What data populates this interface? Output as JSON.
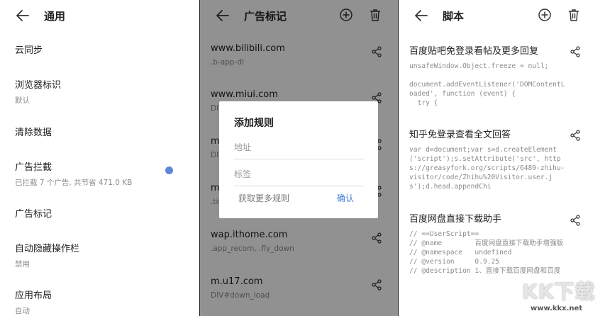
{
  "general": {
    "title": "通用",
    "items": [
      {
        "label": "云同步",
        "sub": ""
      },
      {
        "label": "浏览器标识",
        "sub": "默认"
      },
      {
        "label": "清除数据",
        "sub": ""
      },
      {
        "label": "广告拦截",
        "sub": "已拦截 7 个广告, 共节省 471.0 KB"
      },
      {
        "label": "广告标记",
        "sub": ""
      },
      {
        "label": "自动隐藏操作栏",
        "sub": "禁用"
      },
      {
        "label": "应用布局",
        "sub": "自动"
      }
    ],
    "toggle_color": "#5f87d8"
  },
  "adrules": {
    "title": "广告标记",
    "rows": [
      {
        "domain": "www.bilibili.com",
        "selector": ".b-app-dl"
      },
      {
        "domain": "www.miui.com",
        "selector": "DIV"
      },
      {
        "domain": "m",
        "selector": "DIV"
      },
      {
        "domain": "m",
        "selector": ".tis"
      },
      {
        "domain": "wap.ithome.com",
        "selector": ".app_recom, .fly_down"
      },
      {
        "domain": "m.u17.com",
        "selector": "DIV#down_load"
      }
    ],
    "dialog": {
      "title": "添加规则",
      "address_placeholder": "地址",
      "tag_placeholder": "标签",
      "more_rules": "获取更多规则",
      "confirm": "确认"
    }
  },
  "scripts": {
    "title": "脚本",
    "items": [
      {
        "name": "百度贴吧免登录看帖及更多回复",
        "code": "unsafeWindow.Object.freeze = null;\n\ndocument.addEventListener('DOMContentLoaded', function (event) {\n  try {"
      },
      {
        "name": "知乎免登录查看全文回答",
        "code": "var d=document;var s=d.createElement('script');s.setAttribute('src', https://greasyfork.org/scripts/6489-zhihu-visitor/code/Zhihu%20Visitor.user.js');d.head.appendChi"
      },
      {
        "name": "百度网盘直接下载助手",
        "code": "// ==UserScript==\n// @name        百度网盘直接下载助手增强版\n// @namespace   undefined\n// @version     0.9.25\n// @description 1、直接下载百度网盘和百度"
      }
    ]
  },
  "watermark": {
    "text": "KK下载",
    "url": "www.kkx.net"
  }
}
